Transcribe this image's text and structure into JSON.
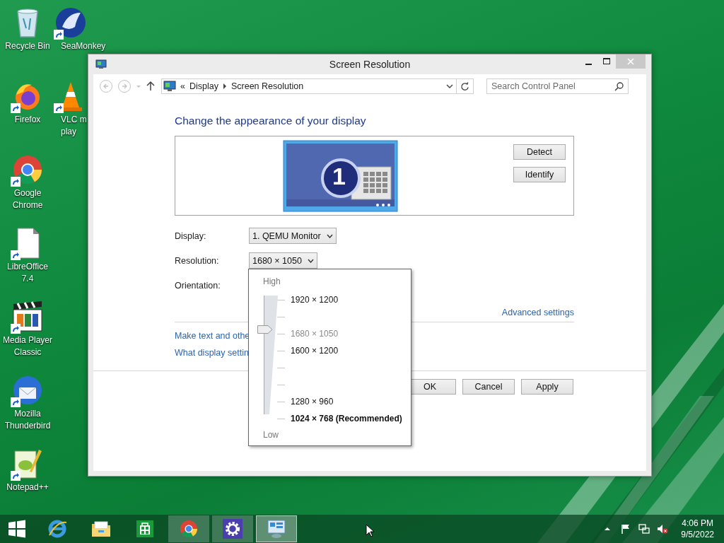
{
  "desktop_icons": [
    {
      "kind": "bin",
      "lines": [
        "Recycle Bin"
      ],
      "shortcut": false
    },
    {
      "kind": "firefox",
      "lines": [
        "Firefox"
      ],
      "shortcut": true
    },
    {
      "kind": "chrome",
      "lines": [
        "Google",
        "Chrome"
      ],
      "shortcut": true
    },
    {
      "kind": "document",
      "lines": [
        "LibreOffice",
        "7.4"
      ],
      "shortcut": true
    },
    {
      "kind": "clapper",
      "lines": [
        "Media Player",
        "Classic"
      ],
      "shortcut": true
    },
    {
      "kind": "thunderbird",
      "lines": [
        "Mozilla",
        "Thunderbird"
      ],
      "shortcut": true
    },
    {
      "kind": "notepad",
      "lines": [
        "Notepad++"
      ],
      "shortcut": true
    },
    {
      "kind": "seamonkey",
      "lines": [
        "SeaMonkey"
      ],
      "shortcut": true
    },
    {
      "kind": "cone",
      "lines": [
        "VLC m",
        "play"
      ],
      "shortcut": true
    }
  ],
  "window": {
    "title": "Screen Resolution",
    "nav": {
      "back_disabled": true,
      "forward_disabled": true
    },
    "address": {
      "overflow_mark": "«",
      "path": [
        "Display",
        "Screen Resolution"
      ]
    },
    "search": {
      "placeholder": "Search Control Panel"
    },
    "heading": "Change the appearance of your display",
    "preview": {
      "monitor_number": "1",
      "buttons": [
        "Detect",
        "Identify"
      ]
    },
    "fields": [
      {
        "kind": "dropdown",
        "label": "Display:",
        "value": "1. QEMU Monitor"
      },
      {
        "kind": "dropdown",
        "label": "Resolution:",
        "value": "1680 × 1050"
      },
      {
        "kind": "hidden",
        "label": "Orientation:"
      }
    ],
    "advanced_link": "Advanced settings",
    "links": [
      "Make text and othe",
      "What display settin"
    ],
    "buttons": [
      "OK",
      "Cancel",
      "Apply"
    ],
    "resolution_menu": {
      "high_label": "High",
      "low_label": "Low",
      "level": 0.714,
      "ticks": [
        {
          "kind": "labelled",
          "label": "1920 × 1200",
          "selected": false,
          "recommended": false
        },
        {
          "kind": "blank"
        },
        {
          "kind": "labelled",
          "label": "1680 × 1050",
          "selected": true,
          "recommended": false
        },
        {
          "kind": "labelled",
          "label": "1600 × 1200",
          "selected": false,
          "recommended": false
        },
        {
          "kind": "blank"
        },
        {
          "kind": "blank"
        },
        {
          "kind": "labelled",
          "label": "1280 × 960",
          "selected": false,
          "recommended": false
        },
        {
          "kind": "labelled",
          "label": "1024 × 768 (Recommended)",
          "selected": false,
          "recommended": true
        }
      ]
    }
  },
  "taskbar": {
    "items": [
      {
        "kind": "start",
        "running": false,
        "active": false
      },
      {
        "kind": "ie",
        "running": false,
        "active": false
      },
      {
        "kind": "explorer",
        "running": false,
        "active": false
      },
      {
        "kind": "store",
        "running": false,
        "active": false
      },
      {
        "kind": "chrome",
        "running": true,
        "active": false
      },
      {
        "kind": "settings",
        "running": true,
        "active": false
      },
      {
        "kind": "controlpanel",
        "running": true,
        "active": true
      }
    ],
    "tray": {
      "volume_muted": true,
      "time": "4:06 PM",
      "date": "9/5/2022"
    }
  }
}
